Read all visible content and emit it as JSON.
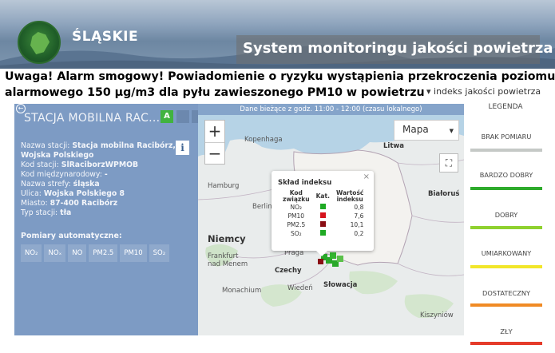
{
  "header": {
    "region_name": "ŚLĄSKIE",
    "system_title": "System monitoringu jakości powietrza"
  },
  "alarm": {
    "line1": "Uwaga! Alarm smogowy!   Powiadomienie o ryzyku wystąpienia przekroczenia  poziomu",
    "line2": "alarmowego 150 µg/m3  dla pyłu zawieszonego PM10 w powietrzu"
  },
  "index_dropdown": {
    "caret": "▾",
    "label": "indeks jakości powietrza"
  },
  "station": {
    "title": "STACJA MOBILNA RAC...",
    "badge": "A",
    "info_icon_glyph": "i",
    "details": [
      {
        "label": "Nazwa stacji:",
        "value": "Stacja mobilna Racibórz, Wojska Polskiego"
      },
      {
        "label": "Kod stacji:",
        "value": "SlRaciborzWPMOB"
      },
      {
        "label": "Kod międzynarodowy:",
        "value": "-"
      },
      {
        "label": "Nazwa strefy:",
        "value": "śląska"
      },
      {
        "label": "Ulica:",
        "value": "Wojska Polskiego 8"
      },
      {
        "label": "Miasto:",
        "value": "87-400 Racibórz"
      },
      {
        "label": "Typ stacji:",
        "value": "tła"
      }
    ],
    "automatic_title": "Pomiary automatyczne:",
    "pollutant_buttons": [
      "NO₂",
      "NOₓ",
      "NO",
      "PM2.5",
      "PM10",
      "SO₂"
    ]
  },
  "map": {
    "data_time": "Dane bieżące z godz. 11:00 - 12:00 (czasu lokalnego)",
    "zoom_in": "+",
    "zoom_out": "−",
    "map_type": "Mapa",
    "labels": {
      "kopenhaga": "Kopenhaga",
      "litwa": "Litwa",
      "hamburg": "Hamburg",
      "berlin": "Berlin",
      "bialorus": "Białoruś",
      "niemcy": "Niemcy",
      "frankfurt": "Frankfurt\nnad Menem",
      "praga": "Praga",
      "czechy": "Czechy",
      "slowacja": "Słowacja",
      "monachium": "Monachium",
      "wieden": "Wiedeń",
      "kiszyniow": "Kiszyniów"
    }
  },
  "popup": {
    "title": "Skład indeksu",
    "close": "×",
    "headers": [
      "Kod\nzwiązku",
      "Kat.",
      "Wartość\nindeksu"
    ],
    "rows": [
      {
        "code": "NO₂",
        "color": "#1faa24",
        "value": "0,8"
      },
      {
        "code": "PM10",
        "color": "#d6141d",
        "value": "7,6"
      },
      {
        "code": "PM2.5",
        "color": "#8a0d14",
        "value": "10,1"
      },
      {
        "code": "SO₂",
        "color": "#1faa24",
        "value": "0,2"
      }
    ]
  },
  "legend": {
    "title": "LEGENDA",
    "items": [
      {
        "label": "BRAK POMIARU",
        "color": "#c5c9c6"
      },
      {
        "label": "BARDZO DOBRY",
        "color": "#2eab2c"
      },
      {
        "label": "DOBRY",
        "color": "#8fd12f"
      },
      {
        "label": "UMIARKOWANY",
        "color": "#f2e62a"
      },
      {
        "label": "DOSTATECZNY",
        "color": "#f08a24"
      },
      {
        "label": "ZŁY",
        "color": "#e53b2a"
      }
    ]
  },
  "colors": {
    "panel_bg": "#7d9bc4",
    "map_bg": "#e9ecec",
    "sea": "#b6d3e6",
    "poland": "#f1f0ed",
    "accent_green": "#41b33f"
  }
}
